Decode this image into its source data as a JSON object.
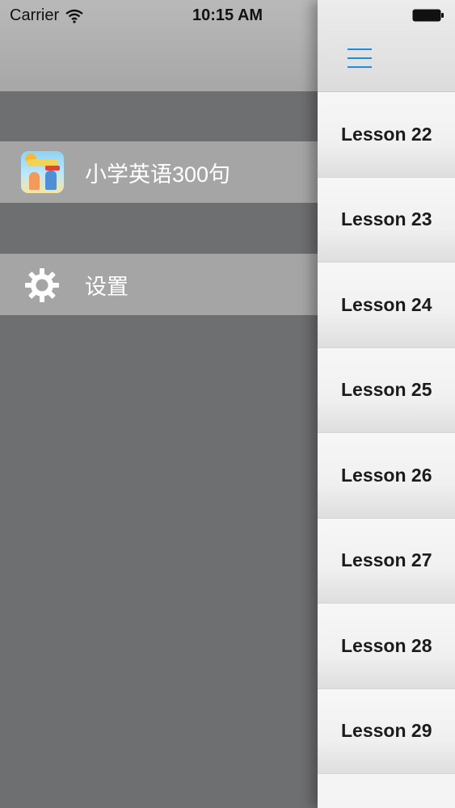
{
  "status_bar": {
    "carrier": "Carrier",
    "time": "10:15 AM"
  },
  "drawer": {
    "items": [
      {
        "label": "小学英语300句",
        "icon": "app-icon"
      },
      {
        "label": "设置",
        "icon": "gear-icon"
      }
    ]
  },
  "nav": {
    "menu_icon": "hamburger-icon",
    "accent_color": "#1a8fe0"
  },
  "lessons": [
    "Lesson 22",
    "Lesson 23",
    "Lesson 24",
    "Lesson 25",
    "Lesson 26",
    "Lesson 27",
    "Lesson 28",
    "Lesson 29"
  ]
}
